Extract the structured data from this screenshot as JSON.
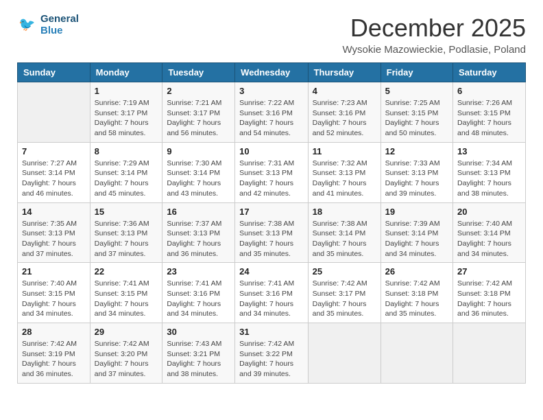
{
  "header": {
    "logo_general": "General",
    "logo_blue": "Blue",
    "month_year": "December 2025",
    "location": "Wysokie Mazowieckie, Podlasie, Poland"
  },
  "weekdays": [
    "Sunday",
    "Monday",
    "Tuesday",
    "Wednesday",
    "Thursday",
    "Friday",
    "Saturday"
  ],
  "weeks": [
    [
      {
        "day": "",
        "info": ""
      },
      {
        "day": "1",
        "info": "Sunrise: 7:19 AM\nSunset: 3:17 PM\nDaylight: 7 hours\nand 58 minutes."
      },
      {
        "day": "2",
        "info": "Sunrise: 7:21 AM\nSunset: 3:17 PM\nDaylight: 7 hours\nand 56 minutes."
      },
      {
        "day": "3",
        "info": "Sunrise: 7:22 AM\nSunset: 3:16 PM\nDaylight: 7 hours\nand 54 minutes."
      },
      {
        "day": "4",
        "info": "Sunrise: 7:23 AM\nSunset: 3:16 PM\nDaylight: 7 hours\nand 52 minutes."
      },
      {
        "day": "5",
        "info": "Sunrise: 7:25 AM\nSunset: 3:15 PM\nDaylight: 7 hours\nand 50 minutes."
      },
      {
        "day": "6",
        "info": "Sunrise: 7:26 AM\nSunset: 3:15 PM\nDaylight: 7 hours\nand 48 minutes."
      }
    ],
    [
      {
        "day": "7",
        "info": "Sunrise: 7:27 AM\nSunset: 3:14 PM\nDaylight: 7 hours\nand 46 minutes."
      },
      {
        "day": "8",
        "info": "Sunrise: 7:29 AM\nSunset: 3:14 PM\nDaylight: 7 hours\nand 45 minutes."
      },
      {
        "day": "9",
        "info": "Sunrise: 7:30 AM\nSunset: 3:14 PM\nDaylight: 7 hours\nand 43 minutes."
      },
      {
        "day": "10",
        "info": "Sunrise: 7:31 AM\nSunset: 3:13 PM\nDaylight: 7 hours\nand 42 minutes."
      },
      {
        "day": "11",
        "info": "Sunrise: 7:32 AM\nSunset: 3:13 PM\nDaylight: 7 hours\nand 41 minutes."
      },
      {
        "day": "12",
        "info": "Sunrise: 7:33 AM\nSunset: 3:13 PM\nDaylight: 7 hours\nand 39 minutes."
      },
      {
        "day": "13",
        "info": "Sunrise: 7:34 AM\nSunset: 3:13 PM\nDaylight: 7 hours\nand 38 minutes."
      }
    ],
    [
      {
        "day": "14",
        "info": "Sunrise: 7:35 AM\nSunset: 3:13 PM\nDaylight: 7 hours\nand 37 minutes."
      },
      {
        "day": "15",
        "info": "Sunrise: 7:36 AM\nSunset: 3:13 PM\nDaylight: 7 hours\nand 37 minutes."
      },
      {
        "day": "16",
        "info": "Sunrise: 7:37 AM\nSunset: 3:13 PM\nDaylight: 7 hours\nand 36 minutes."
      },
      {
        "day": "17",
        "info": "Sunrise: 7:38 AM\nSunset: 3:13 PM\nDaylight: 7 hours\nand 35 minutes."
      },
      {
        "day": "18",
        "info": "Sunrise: 7:38 AM\nSunset: 3:14 PM\nDaylight: 7 hours\nand 35 minutes."
      },
      {
        "day": "19",
        "info": "Sunrise: 7:39 AM\nSunset: 3:14 PM\nDaylight: 7 hours\nand 34 minutes."
      },
      {
        "day": "20",
        "info": "Sunrise: 7:40 AM\nSunset: 3:14 PM\nDaylight: 7 hours\nand 34 minutes."
      }
    ],
    [
      {
        "day": "21",
        "info": "Sunrise: 7:40 AM\nSunset: 3:15 PM\nDaylight: 7 hours\nand 34 minutes."
      },
      {
        "day": "22",
        "info": "Sunrise: 7:41 AM\nSunset: 3:15 PM\nDaylight: 7 hours\nand 34 minutes."
      },
      {
        "day": "23",
        "info": "Sunrise: 7:41 AM\nSunset: 3:16 PM\nDaylight: 7 hours\nand 34 minutes."
      },
      {
        "day": "24",
        "info": "Sunrise: 7:41 AM\nSunset: 3:16 PM\nDaylight: 7 hours\nand 34 minutes."
      },
      {
        "day": "25",
        "info": "Sunrise: 7:42 AM\nSunset: 3:17 PM\nDaylight: 7 hours\nand 35 minutes."
      },
      {
        "day": "26",
        "info": "Sunrise: 7:42 AM\nSunset: 3:18 PM\nDaylight: 7 hours\nand 35 minutes."
      },
      {
        "day": "27",
        "info": "Sunrise: 7:42 AM\nSunset: 3:18 PM\nDaylight: 7 hours\nand 36 minutes."
      }
    ],
    [
      {
        "day": "28",
        "info": "Sunrise: 7:42 AM\nSunset: 3:19 PM\nDaylight: 7 hours\nand 36 minutes."
      },
      {
        "day": "29",
        "info": "Sunrise: 7:42 AM\nSunset: 3:20 PM\nDaylight: 7 hours\nand 37 minutes."
      },
      {
        "day": "30",
        "info": "Sunrise: 7:43 AM\nSunset: 3:21 PM\nDaylight: 7 hours\nand 38 minutes."
      },
      {
        "day": "31",
        "info": "Sunrise: 7:42 AM\nSunset: 3:22 PM\nDaylight: 7 hours\nand 39 minutes."
      },
      {
        "day": "",
        "info": ""
      },
      {
        "day": "",
        "info": ""
      },
      {
        "day": "",
        "info": ""
      }
    ]
  ]
}
